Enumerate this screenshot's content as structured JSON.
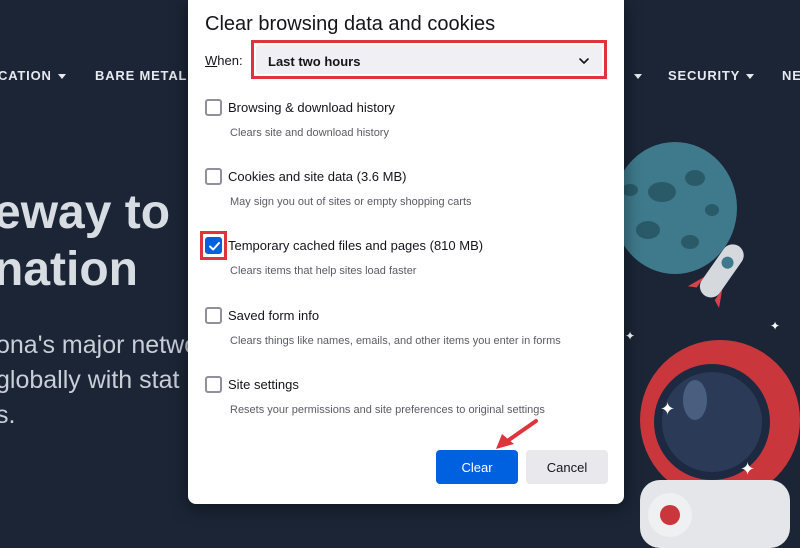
{
  "background": {
    "nav": [
      {
        "label": "CATION"
      },
      {
        "label": "BARE METAL C"
      },
      {
        "label": "SECURITY"
      },
      {
        "label": "NE"
      }
    ],
    "hero_title_1": "eway to",
    "hero_title_2": "nation",
    "hero_text_1": "ona's major netwo",
    "hero_text_2": "globally with stat",
    "hero_text_3": "s."
  },
  "dialog": {
    "title": "Clear browsing data and cookies",
    "when_label_underlined": "W",
    "when_label_rest": "hen:",
    "when_value": "Last two hours",
    "options": [
      {
        "label": "Browsing & download history",
        "description": "Clears site and download history",
        "checked": false
      },
      {
        "label": "Cookies and site data (3.6 MB)",
        "description": "May sign you out of sites or empty shopping carts",
        "checked": false
      },
      {
        "label": "Temporary cached files and pages (810 MB)",
        "description": "Clears items that help sites load faster",
        "checked": true
      },
      {
        "label": "Saved form info",
        "description": "Clears things like names, emails, and other items you enter in forms",
        "checked": false
      },
      {
        "label": "Site settings",
        "description": "Resets your permissions and site preferences to original settings",
        "checked": false
      }
    ],
    "clear_label": "Clear",
    "cancel_label": "Cancel"
  },
  "colors": {
    "accent": "#0061e0",
    "highlight": "#e0343c",
    "background": "#1b2536"
  }
}
